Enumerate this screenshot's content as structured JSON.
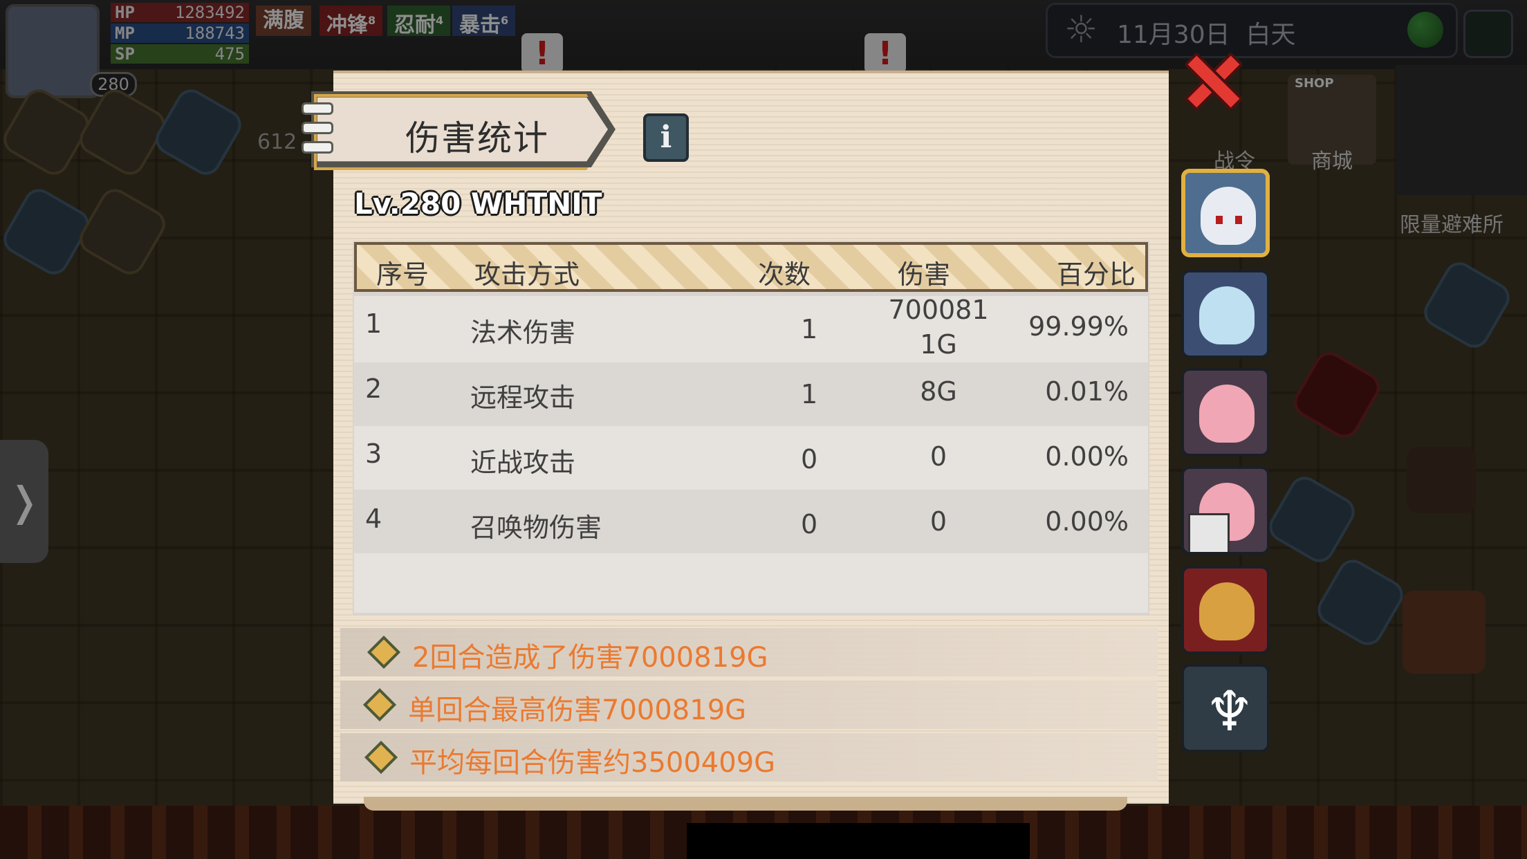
{
  "hud": {
    "hp_label": "HP",
    "hp_value": "1283492",
    "mp_label": "MP",
    "mp_value": "188743",
    "sp_label": "SP",
    "sp_value": "475",
    "level": "280",
    "buffs": [
      {
        "label": "满腹",
        "sup": "",
        "color": "#6b3a2a"
      },
      {
        "label": "冲锋",
        "sup": "8",
        "color": "#7a1f1f"
      },
      {
        "label": "忍耐",
        "sup": "4",
        "color": "#2c5a2c"
      },
      {
        "label": "暴击",
        "sup": "6",
        "color": "#2c3f6b"
      }
    ],
    "side_number": "612"
  },
  "top_right": {
    "date": "11月30日",
    "period": "白天",
    "war_label": "战令",
    "shop_sign": "SHOP",
    "shop_label": "商城",
    "refuge_label": "限量避难所"
  },
  "nav": {
    "expand_glyph": "❭"
  },
  "dialog": {
    "title": "伤害统计",
    "info_glyph": "i",
    "close_glyph": "",
    "player_line": "Lv.280  WHTNIT",
    "columns": [
      "序号",
      "攻击方式",
      "次数",
      "伤害",
      "百分比"
    ],
    "rows": [
      {
        "index": "1",
        "method": "法术伤害",
        "count": "1",
        "damage_line1": "700081",
        "damage_line2": "1G",
        "percent": "99.99%"
      },
      {
        "index": "2",
        "method": "远程攻击",
        "count": "1",
        "damage_line1": "8G",
        "damage_line2": "",
        "percent": "0.01%"
      },
      {
        "index": "3",
        "method": "近战攻击",
        "count": "0",
        "damage_line1": "0",
        "damage_line2": "",
        "percent": "0.00%"
      },
      {
        "index": "4",
        "method": "召唤物伤害",
        "count": "0",
        "damage_line1": "0",
        "damage_line2": "",
        "percent": "0.00%"
      }
    ],
    "summary": [
      "2回合造成了伤害7000819G",
      "单回合最高伤害7000819G",
      "平均每回合伤害约3500409G"
    ]
  },
  "party": [
    {
      "name": "silver-hair-hero",
      "active": true
    },
    {
      "name": "blue-hair-mage",
      "active": false
    },
    {
      "name": "pink-hair-nurse",
      "active": false
    },
    {
      "name": "pink-hair-nurse-with-book",
      "active": false
    },
    {
      "name": "red-robed-priest",
      "active": false
    },
    {
      "name": "white-deer-emblem",
      "active": false
    }
  ],
  "colors": {
    "dialog_bg": "#eee1cd",
    "summary_text": "#ea7a30",
    "close_red": "#e23a32",
    "active_portrait_border": "#e0b040"
  }
}
